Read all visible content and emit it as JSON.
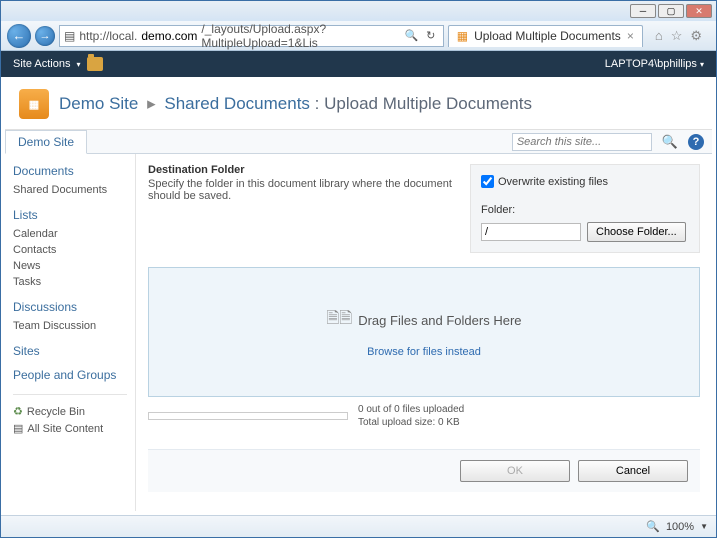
{
  "window": {
    "url_prefix": "http://local.",
    "url_domain": "demo.com",
    "url_suffix": "/_layouts/Upload.aspx?MultipleUpload=1&Lis",
    "tab_title": "Upload Multiple Documents"
  },
  "ribbon": {
    "site_actions": "Site Actions",
    "user": "LAPTOP4\\bphillips"
  },
  "breadcrumb": {
    "site": "Demo Site",
    "library": "Shared Documents",
    "page": "Upload Multiple Documents"
  },
  "topnav": {
    "tab": "Demo Site",
    "search_placeholder": "Search this site..."
  },
  "leftnav": {
    "h_documents": "Documents",
    "documents": [
      "Shared Documents"
    ],
    "h_lists": "Lists",
    "lists": [
      "Calendar",
      "Contacts",
      "News",
      "Tasks"
    ],
    "h_discussions": "Discussions",
    "discussions": [
      "Team Discussion"
    ],
    "h_sites": "Sites",
    "h_people": "People and Groups",
    "recycle": "Recycle Bin",
    "allcontent": "All Site Content"
  },
  "main": {
    "dest_title": "Destination Folder",
    "dest_sub": "Specify the folder in this document library where the document should be saved.",
    "overwrite_label": "Overwrite existing files",
    "overwrite_checked": true,
    "folder_label": "Folder:",
    "folder_value": "/",
    "choose_folder": "Choose Folder...",
    "drop_text": "Drag Files and Folders Here",
    "browse_link": "Browse for files instead",
    "progress_count": "0 out of 0 files uploaded",
    "progress_size": "Total upload size: 0 KB",
    "ok": "OK",
    "cancel": "Cancel"
  },
  "status": {
    "zoom": "100%"
  }
}
